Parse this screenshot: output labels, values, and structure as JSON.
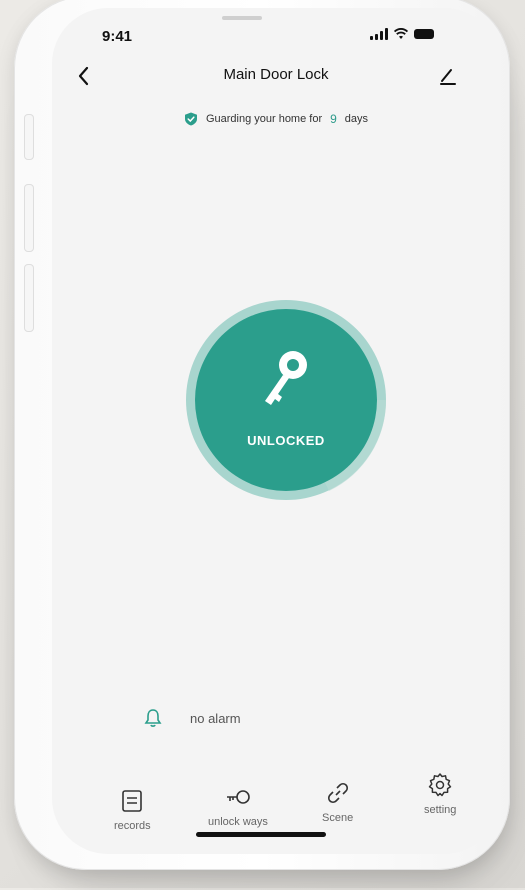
{
  "status_bar": {
    "time": "9:41"
  },
  "header": {
    "title": "Main Door Lock"
  },
  "guard": {
    "prefix": "Guarding your home for",
    "days": "9",
    "suffix": "days"
  },
  "lock": {
    "state": "UNLOCKED"
  },
  "alarm": {
    "text": "no alarm"
  },
  "nav": {
    "records": "records",
    "unlock_ways": "unlock ways",
    "scene": "Scene",
    "setting": "setting"
  },
  "colors": {
    "accent": "#2b9e8c",
    "ring": "#a8d5ce"
  }
}
